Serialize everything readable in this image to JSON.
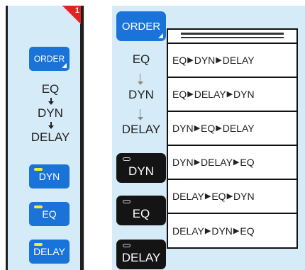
{
  "left": {
    "badge": "1",
    "order_label": "ORDER",
    "chain": [
      "EQ",
      "DYN",
      "DELAY"
    ],
    "buttons": [
      {
        "label": "DYN"
      },
      {
        "label": "EQ"
      },
      {
        "label": "DELAY"
      }
    ]
  },
  "right": {
    "order_label": "ORDER",
    "chain": [
      "EQ",
      "DYN",
      "DELAY"
    ],
    "buttons": [
      {
        "label": "DYN"
      },
      {
        "label": "EQ"
      },
      {
        "label": "DELAY"
      }
    ],
    "options": [
      [
        "EQ",
        "DYN",
        "DELAY"
      ],
      [
        "EQ",
        "DELAY",
        "DYN"
      ],
      [
        "DYN",
        "EQ",
        "DELAY"
      ],
      [
        "DYN",
        "DELAY",
        "EQ"
      ],
      [
        "DELAY",
        "EQ",
        "DYN"
      ],
      [
        "DELAY",
        "DYN",
        "EQ"
      ]
    ]
  },
  "colors": {
    "panel_bg": "#d6ebf8",
    "button_blue": "#1a73d8",
    "button_black": "#141414",
    "led_yellow": "#f4ea3a",
    "badge_red": "#e52222"
  },
  "icons": [
    "right-arrow-icon",
    "down-arrow-icon",
    "led-indicator-icon",
    "corner-triangle-icon"
  ]
}
